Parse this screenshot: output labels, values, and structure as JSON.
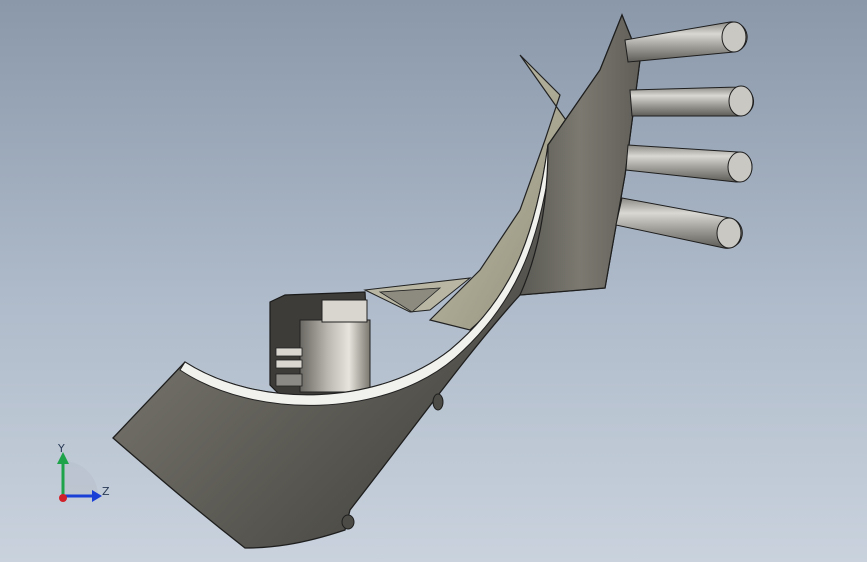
{
  "viewport": {
    "background_top": "#8a98aa",
    "background_bottom": "#c9d2dd"
  },
  "model": {
    "surface_color": "#6f6d65",
    "edge_color": "#1e1e1e",
    "pin_count": 4
  },
  "triad": {
    "y_label": "Y",
    "z_label": "Z",
    "y_color": "#1fa34a",
    "z_color": "#1a3fd6",
    "x_color": "#d0202a"
  }
}
